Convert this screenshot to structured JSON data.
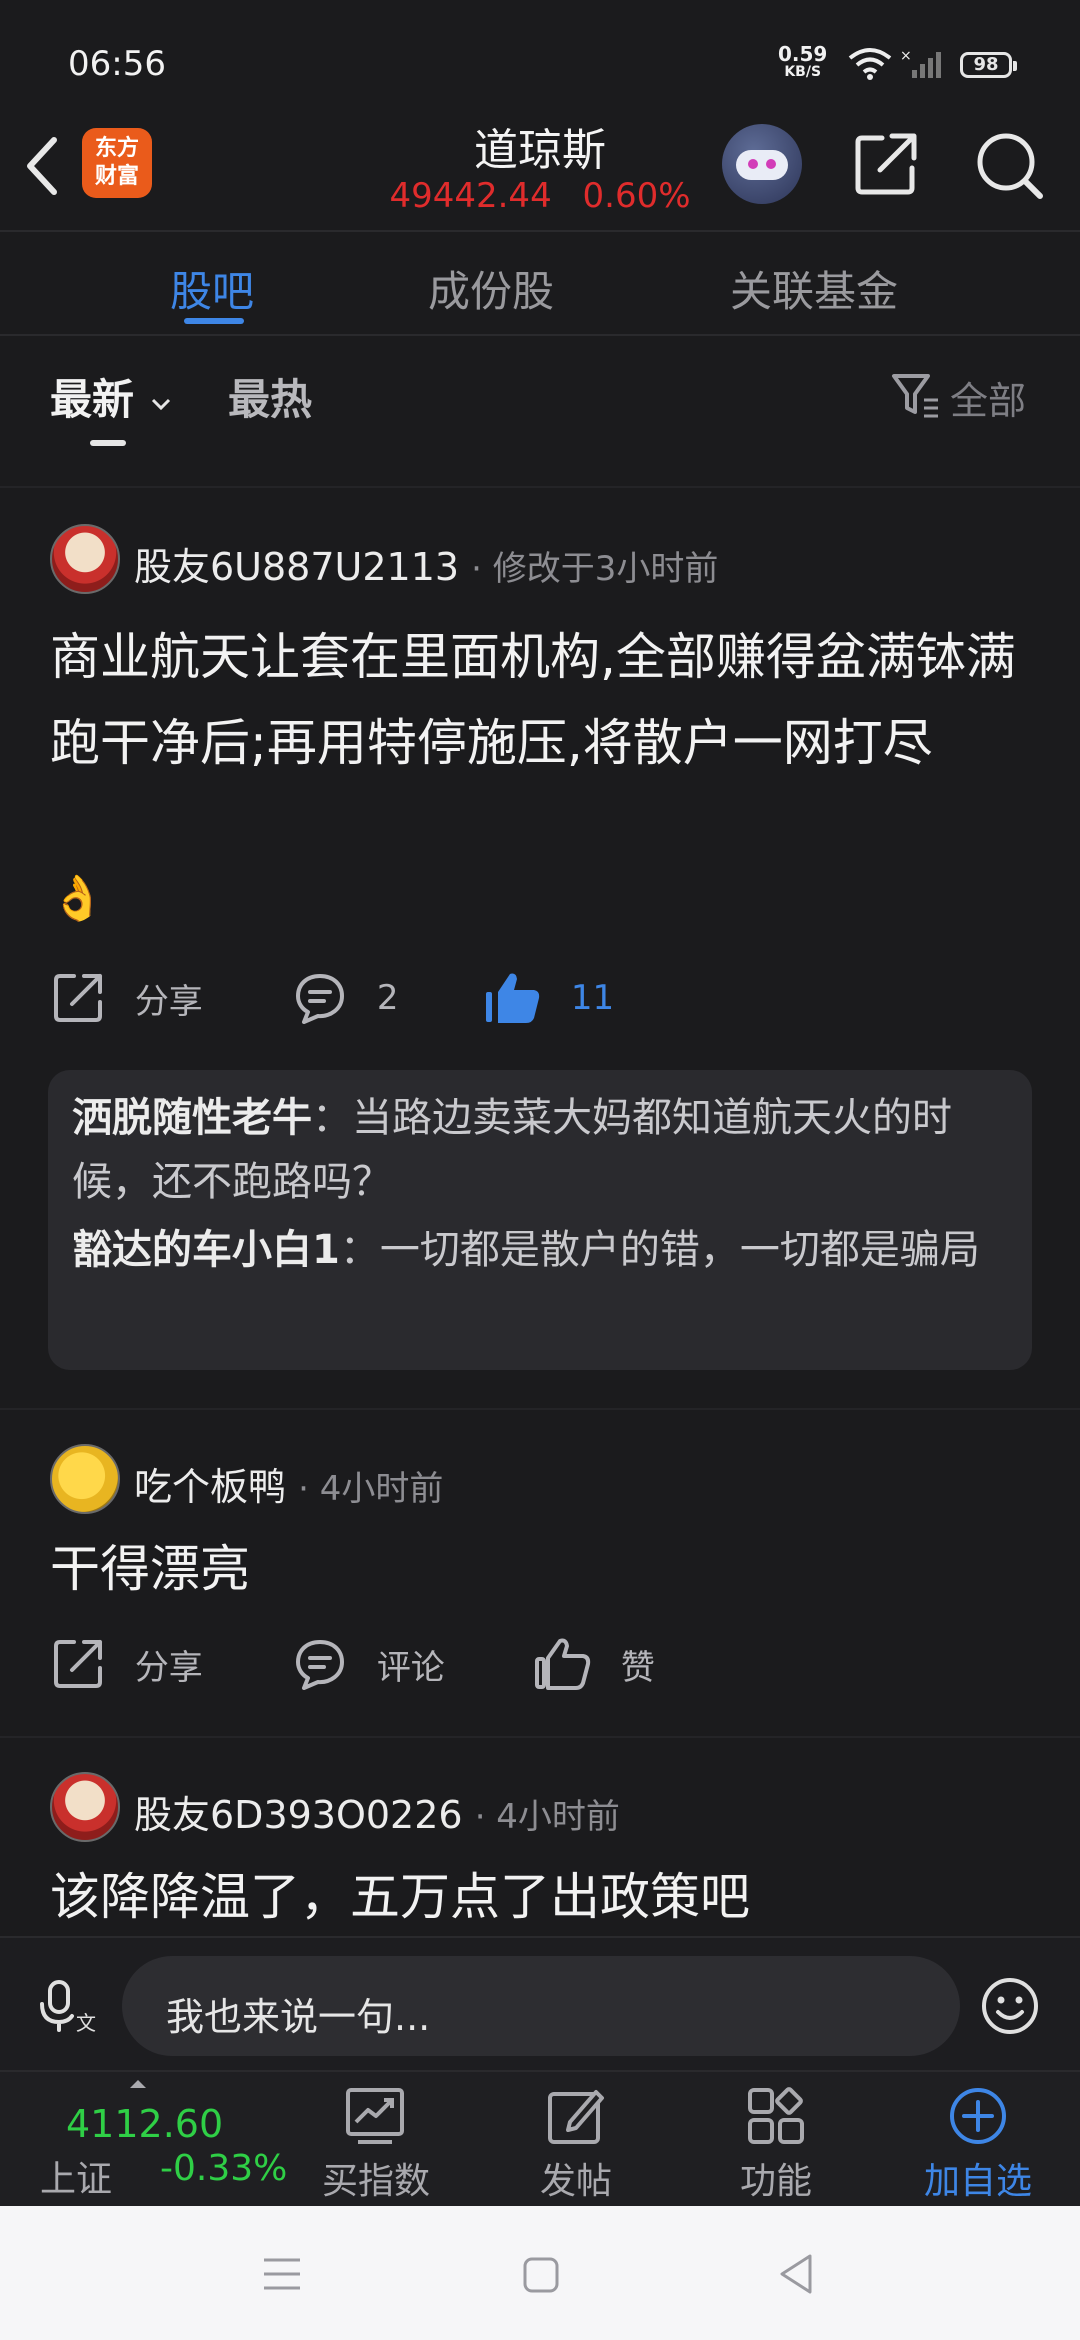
{
  "status_bar": {
    "time": "06:56",
    "net_speed_value": "0.59",
    "net_speed_unit": "KB/S",
    "battery": "98"
  },
  "header": {
    "logo_line1": "东方",
    "logo_line2": "财富",
    "title": "道琼斯",
    "price": "49442.44",
    "change_pct": "0.60%"
  },
  "tabs": [
    {
      "label": "股吧"
    },
    {
      "label": "成份股"
    },
    {
      "label": "关联基金"
    }
  ],
  "filters": {
    "latest": "最新",
    "hot": "最热",
    "all": "全部"
  },
  "posts": [
    {
      "username": "股友6U887U2113",
      "meta": "· 修改于3小时前",
      "content": "商业航天让套在里面机构,全部赚得盆满钵满跑干净后;再用特停施压,将散户一网打尽",
      "emoji": "👌",
      "share": "分享",
      "comments": "2",
      "likes": "11",
      "replies": [
        {
          "user": "洒脱随性老牛",
          "text": "：当路边卖菜大妈都知道航天火的时候，还不跑路吗？"
        },
        {
          "user": "豁达的车小白1",
          "text": "：一切都是散户的错，一切都是骗局"
        }
      ]
    },
    {
      "username": "吃个板鸭",
      "meta": "· 4小时前",
      "content": "干得漂亮",
      "share": "分享",
      "comments": "评论",
      "likes": "赞"
    },
    {
      "username": "股友6D393O0226",
      "meta": "· 4小时前",
      "content": "该降降温了，五万点了出政策吧"
    }
  ],
  "input_bar": {
    "placeholder": "我也来说一句..."
  },
  "bottom_nav": {
    "index_value": "4112.60",
    "index_name": "上证",
    "index_change": "-0.33%",
    "buy_index": "买指数",
    "post": "发帖",
    "functions": "功能",
    "add_watch": "加自选"
  },
  "colors": {
    "accent_blue": "#3e86e6",
    "price_red": "#e02c2c",
    "down_green": "#2fcf46",
    "background": "#1b1b1d"
  }
}
